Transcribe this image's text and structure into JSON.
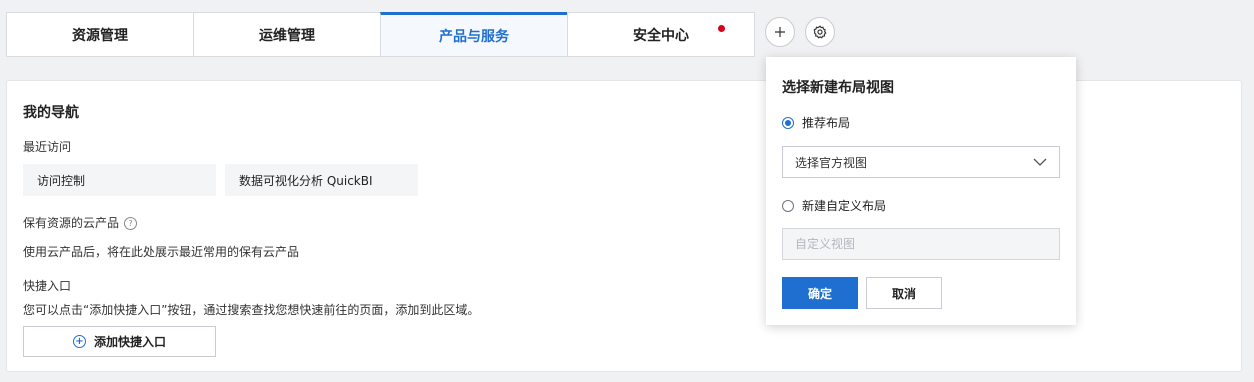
{
  "tabs": [
    {
      "label": "资源管理",
      "active": false
    },
    {
      "label": "运维管理",
      "active": false
    },
    {
      "label": "产品与服务",
      "active": true
    },
    {
      "label": "安全中心",
      "active": false,
      "badge": "red-dot"
    }
  ],
  "toolbar": {
    "add_icon": "plus-icon",
    "settings_icon": "gear-icon"
  },
  "nav": {
    "title": "我的导航",
    "recent_label": "最近访问",
    "recent_items": [
      "访问控制",
      "数据可视化分析 QuickBI"
    ],
    "owned_label": "保有资源的云产品",
    "owned_help_icon": "help-circle-icon",
    "owned_desc": "使用云产品后，将在此处展示最近常用的保有云产品",
    "quick_label": "快捷入口",
    "quick_desc": "您可以点击“添加快捷入口”按钮，通过搜索查找您想快速前往的页面，添加到此区域。",
    "add_quick_button": "添加快捷入口"
  },
  "popover": {
    "title": "选择新建布局视图",
    "option_recommended": "推荐布局",
    "option_recommended_checked": true,
    "select_value": "选择官方视图",
    "option_custom": "新建自定义布局",
    "option_custom_checked": false,
    "custom_placeholder": "自定义视图",
    "confirm_button": "确定",
    "cancel_button": "取消"
  },
  "colors": {
    "accent": "#1f6fd1",
    "badge": "#d9001b"
  }
}
